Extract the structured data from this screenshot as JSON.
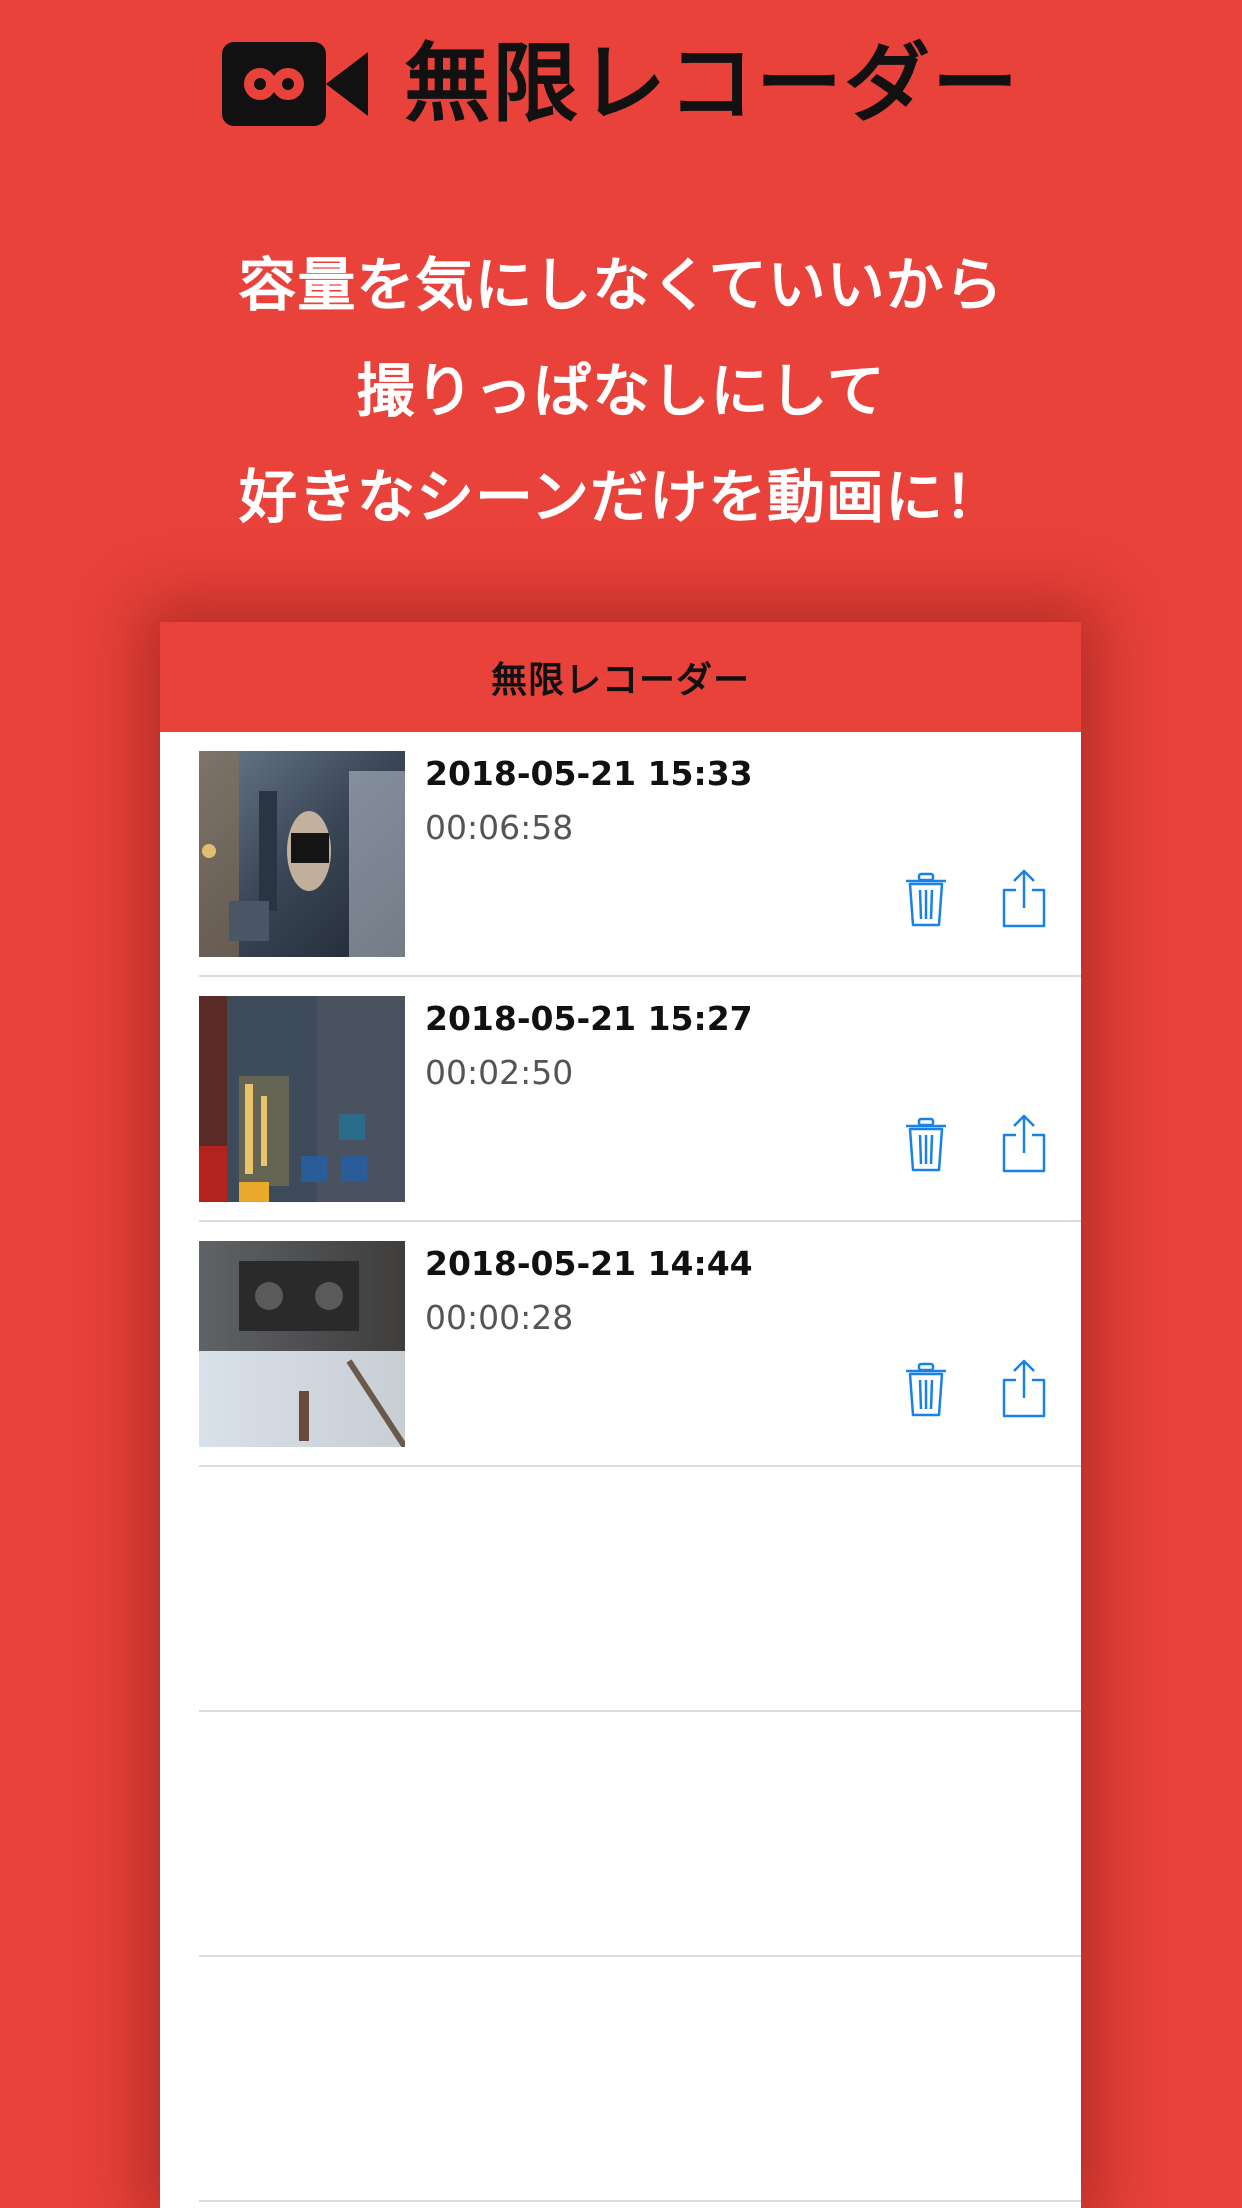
{
  "promo": {
    "logo_icon": "infinity-video-camera-icon",
    "title": "無限レコーダー",
    "tagline_1": "容量を気にしなくていいから",
    "tagline_2": "撮りっぱなしにして",
    "tagline_3": "好きなシーンだけを動画に！"
  },
  "app": {
    "nav_title": "無限レコーダー",
    "recordings": [
      {
        "date": "2018-05-21 15:33",
        "duration": "00:06:58",
        "thumbnail": "game-scene-character-thumbnail"
      },
      {
        "date": "2018-05-21 15:27",
        "duration": "00:02:50",
        "thumbnail": "game-event-menu-thumbnail"
      },
      {
        "date": "2018-05-21 14:44",
        "duration": "00:00:28",
        "thumbnail": "game-vehicle-scene-thumbnail"
      }
    ],
    "row_actions": {
      "delete_icon": "trash-icon",
      "share_icon": "share-icon"
    }
  },
  "colors": {
    "background": "#e8423a",
    "nav_bar": "#e8423a",
    "accent": "#1a82e6",
    "title_text": "#111111",
    "tagline_text": "#ffffff"
  }
}
